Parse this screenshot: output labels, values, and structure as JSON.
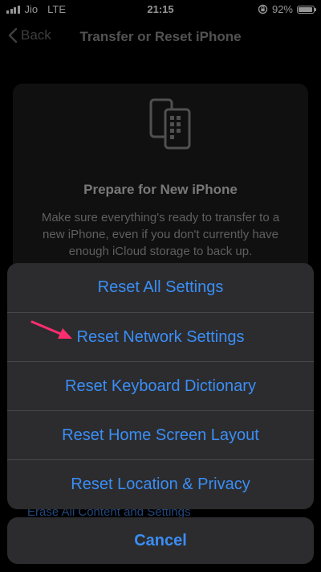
{
  "status": {
    "carrier": "Jio",
    "network": "LTE",
    "time": "21:15",
    "battery": "92%",
    "battery_level": 0.92
  },
  "nav": {
    "back_label": "Back",
    "title": "Transfer or Reset iPhone"
  },
  "card": {
    "title": "Prepare for New iPhone",
    "description": "Make sure everything's ready to transfer to a new iPhone, even if you don't currently have enough iCloud storage to back up."
  },
  "erase_link": "Erase All Content and Settings",
  "action_sheet": {
    "items": [
      "Reset All Settings",
      "Reset Network Settings",
      "Reset Keyboard Dictionary",
      "Reset Home Screen Layout",
      "Reset Location & Privacy"
    ],
    "cancel_label": "Cancel"
  },
  "colors": {
    "accent": "#3a8ef6",
    "annotation_arrow": "#ff2d6f"
  }
}
